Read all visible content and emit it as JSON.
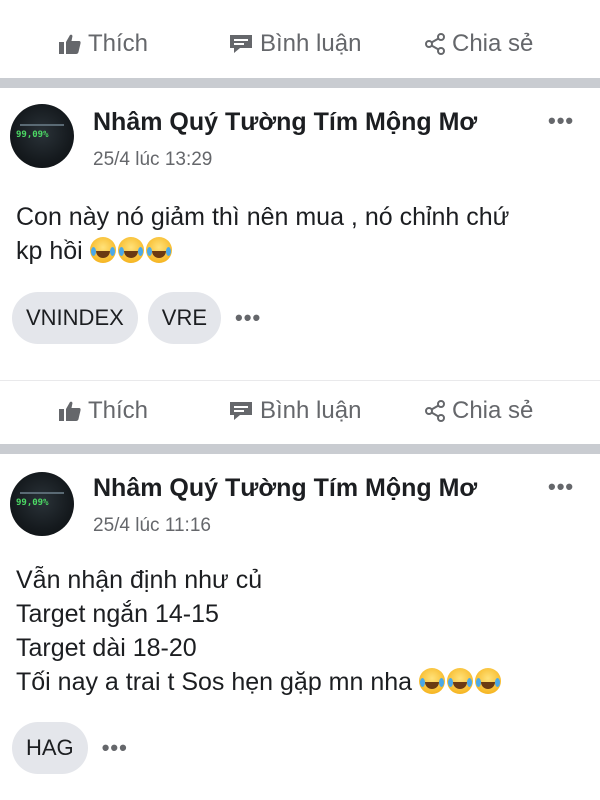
{
  "actions": {
    "like_label": "Thích",
    "comment_label": "Bình luận",
    "share_label": "Chia sẻ"
  },
  "avatar": {
    "overlay_text": "99,09%"
  },
  "posts": [
    {
      "author": "Nhâm Quý Tường Tím Mộng Mơ",
      "time": "25/4 lúc 13:29",
      "lines": [
        "Con này nó giảm thì nên mua , nó chỉnh chứ",
        "kp hồi"
      ],
      "emoji": [
        "😂",
        "😂",
        "😂"
      ],
      "tags": [
        "VNINDEX",
        "VRE"
      ],
      "more_label": "•••"
    },
    {
      "author": "Nhâm Quý Tường Tím Mộng Mơ",
      "time": "25/4 lúc 11:16",
      "lines": [
        "Vẫn nhận định như củ",
        "Target ngắn 14-15",
        "Target dài 18-20",
        "Tối nay a trai t Sos hẹn gặp mn nha"
      ],
      "emoji": [
        "😂",
        "😂",
        "😂"
      ],
      "tags": [
        "HAG"
      ],
      "more_label": "•••"
    }
  ],
  "colors": {
    "secondary_text": "#65676b",
    "divider": "#c9ccd1",
    "tag_bg": "#e4e6eb"
  },
  "icons": {
    "like": "thumbs-up-icon",
    "comment": "comment-icon",
    "share": "share-icon",
    "more": "more-dots-icon"
  }
}
